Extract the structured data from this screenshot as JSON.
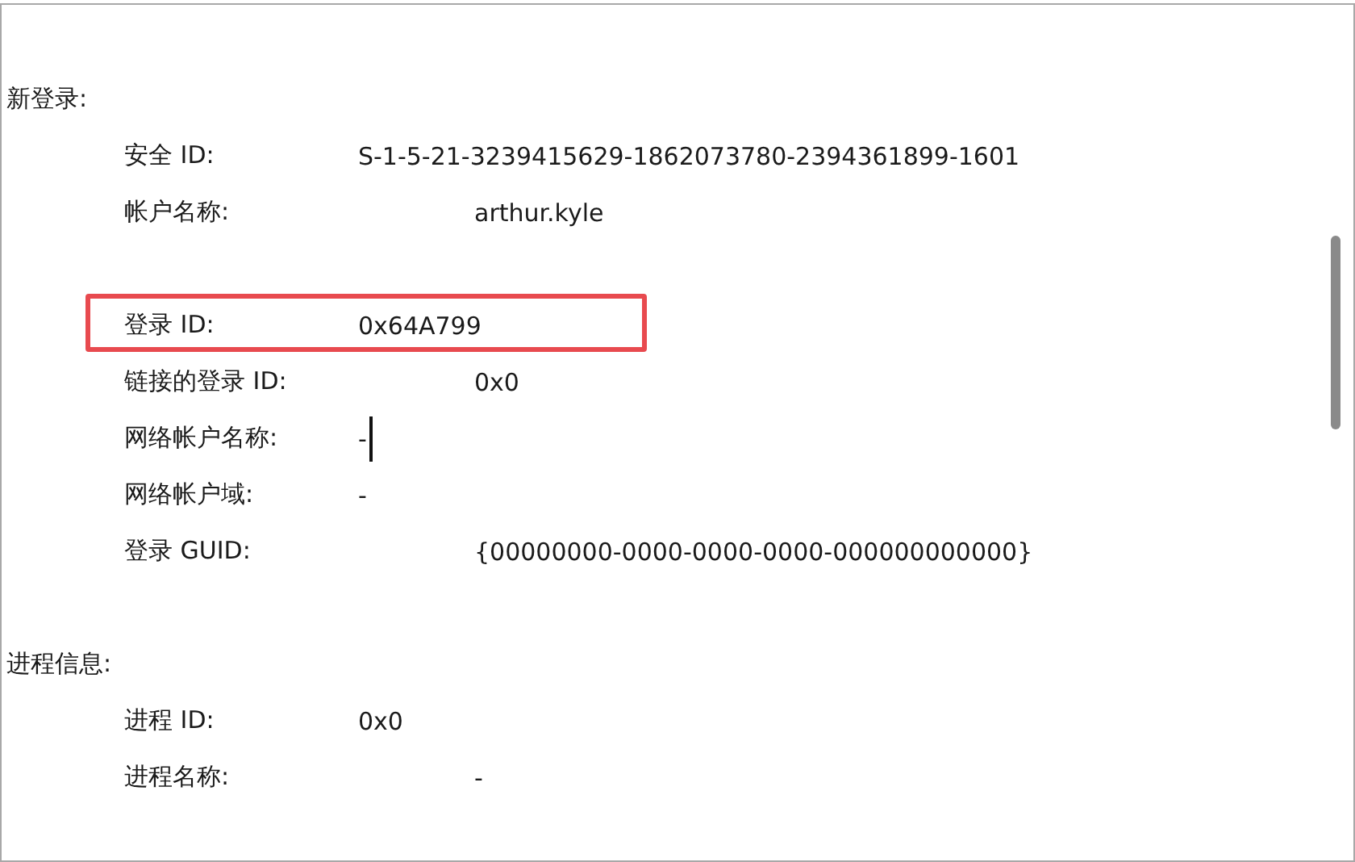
{
  "sections": [
    {
      "title": "新登录:",
      "groups": [
        {
          "fields": [
            {
              "label": "安全 ID:",
              "value": "S-1-5-21-3239415629-1862073780-2394361899-1601",
              "kind": "near",
              "highlighted": false,
              "caret": false
            },
            {
              "label": "帐户名称:",
              "value": "arthur.kyle",
              "kind": "far",
              "highlighted": false,
              "caret": false
            }
          ]
        },
        {
          "fields": [
            {
              "label": "登录 ID:",
              "value": "0x64A799",
              "kind": "near",
              "highlighted": true,
              "caret": false
            },
            {
              "label": "链接的登录 ID:",
              "value": "0x0",
              "kind": "far",
              "highlighted": false,
              "caret": false
            },
            {
              "label": "网络帐户名称:",
              "value": "-",
              "kind": "near",
              "highlighted": false,
              "caret": true
            },
            {
              "label": "网络帐户域:",
              "value": "-",
              "kind": "near",
              "highlighted": false,
              "caret": false
            },
            {
              "label": "登录 GUID:",
              "value": "{00000000-0000-0000-0000-000000000000}",
              "kind": "far",
              "highlighted": false,
              "caret": false
            }
          ]
        }
      ]
    },
    {
      "title": "进程信息:",
      "groups": [
        {
          "fields": [
            {
              "label": "进程 ID:",
              "value": "0x0",
              "kind": "near",
              "highlighted": false,
              "caret": false
            },
            {
              "label": "进程名称:",
              "value": "-",
              "kind": "far",
              "highlighted": false,
              "caret": false
            }
          ]
        }
      ]
    }
  ]
}
